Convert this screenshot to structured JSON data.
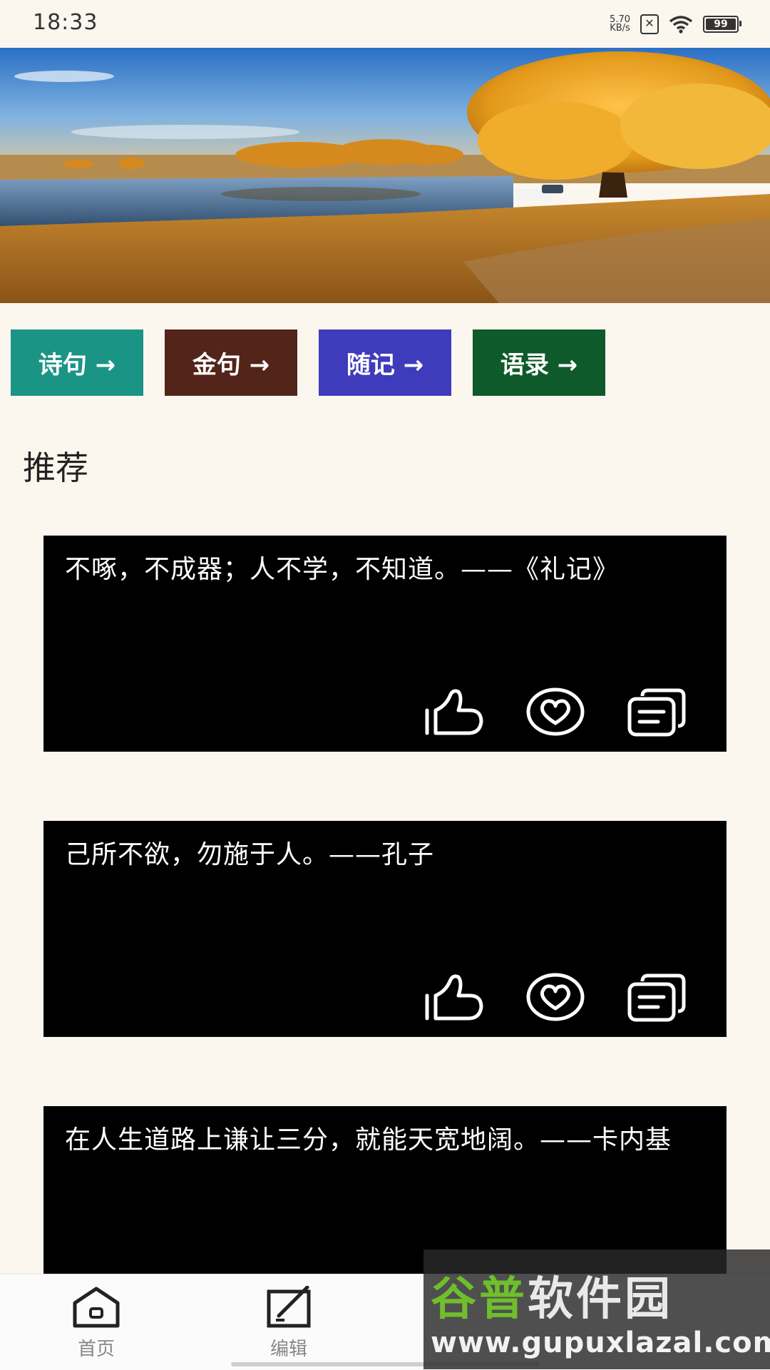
{
  "status_bar": {
    "time": "18:33",
    "network_speed": "5.70",
    "network_unit": "KB/s",
    "battery": "99"
  },
  "banner": {
    "image": "autumn-lake-landscape"
  },
  "categories": [
    {
      "label": "诗句 →",
      "color": "#1a9485"
    },
    {
      "label": "金句 →",
      "color": "#532419"
    },
    {
      "label": "随记 →",
      "color": "#3f3bbd"
    },
    {
      "label": "语录 →",
      "color": "#0e5a2b"
    }
  ],
  "section_title": "推荐",
  "cards": [
    {
      "text": "不啄，不成器；人不学，不知道。——《礼记》"
    },
    {
      "text": "己所不欲，勿施于人。——孔子"
    },
    {
      "text": "在人生道路上谦让三分，就能天宽地阔。——卡内基"
    }
  ],
  "bottom_nav": {
    "items": [
      {
        "label": "首页",
        "icon": "home-icon"
      },
      {
        "label": "编辑",
        "icon": "edit-icon"
      }
    ]
  },
  "watermark": {
    "title_green": "谷普",
    "title_gray": "软件园",
    "url": "www.gupuxlazal.com"
  }
}
